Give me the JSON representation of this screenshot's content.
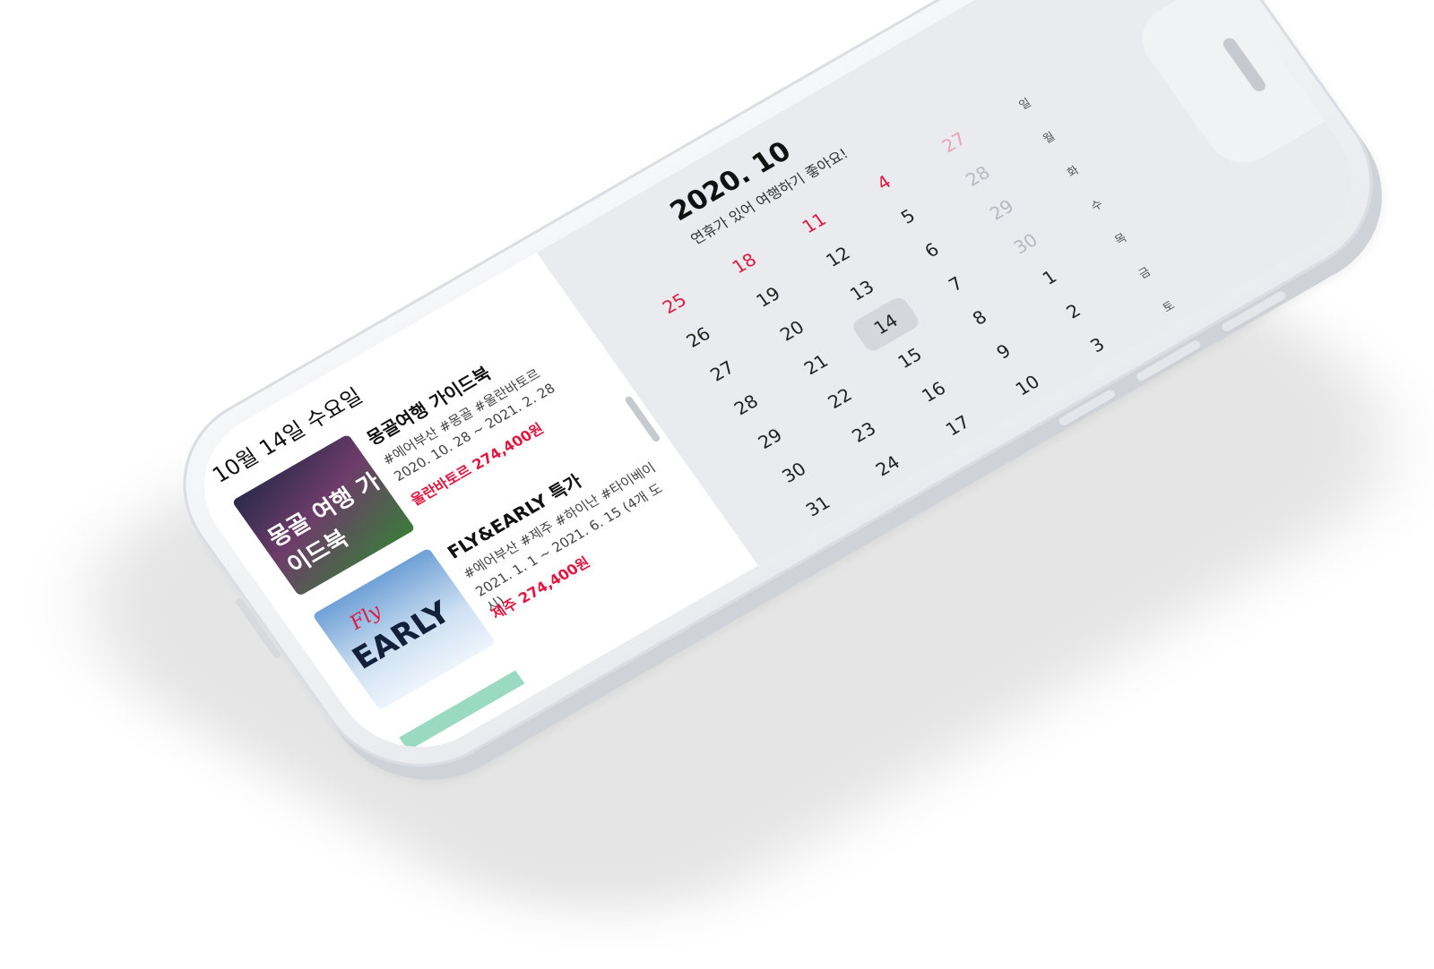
{
  "header": {
    "back_icon": "chevron-left-icon",
    "back_label": "<",
    "month_title": "2020. 10",
    "subtitle": "연휴가 있어 여행하기 좋아요!"
  },
  "calendar": {
    "weekdays": [
      "일",
      "월",
      "화",
      "수",
      "목",
      "금",
      "토"
    ],
    "weeks": [
      [
        "27",
        "28",
        "29",
        "30",
        "1",
        "2",
        "3"
      ],
      [
        "4",
        "5",
        "6",
        "7",
        "8",
        "9",
        "10"
      ],
      [
        "11",
        "12",
        "13",
        "14",
        "15",
        "16",
        "17"
      ],
      [
        "18",
        "19",
        "20",
        "21",
        "22",
        "23",
        "24"
      ],
      [
        "25",
        "26",
        "27",
        "28",
        "29",
        "30",
        "31"
      ]
    ],
    "selected_day": "14",
    "colors": {
      "holiday": "#e0183f",
      "muted": "#b7babf",
      "selected_bg": "#d5d7dc"
    }
  },
  "list": {
    "date_heading": "10월 14일 수요일",
    "items": [
      {
        "title": "몽골여행 가이드북",
        "tags": "#에어부산 #몽골 #울란바토르",
        "dates": "2020. 10. 28 ~ 2021. 2. 28",
        "price": "울란바토르 274,400원",
        "thumb_text": "몽골 여행 가이드북"
      },
      {
        "title": "FLY&EARLY 특가",
        "tags": "#에어부산 #제주 #하이난 #타이베이",
        "dates": "2021. 1. 1 ~ 2021. 6. 15 (4개 도시)",
        "price": "제주 274,400원",
        "thumb_text": "EARLY",
        "thumb_script": "Fly"
      }
    ]
  }
}
